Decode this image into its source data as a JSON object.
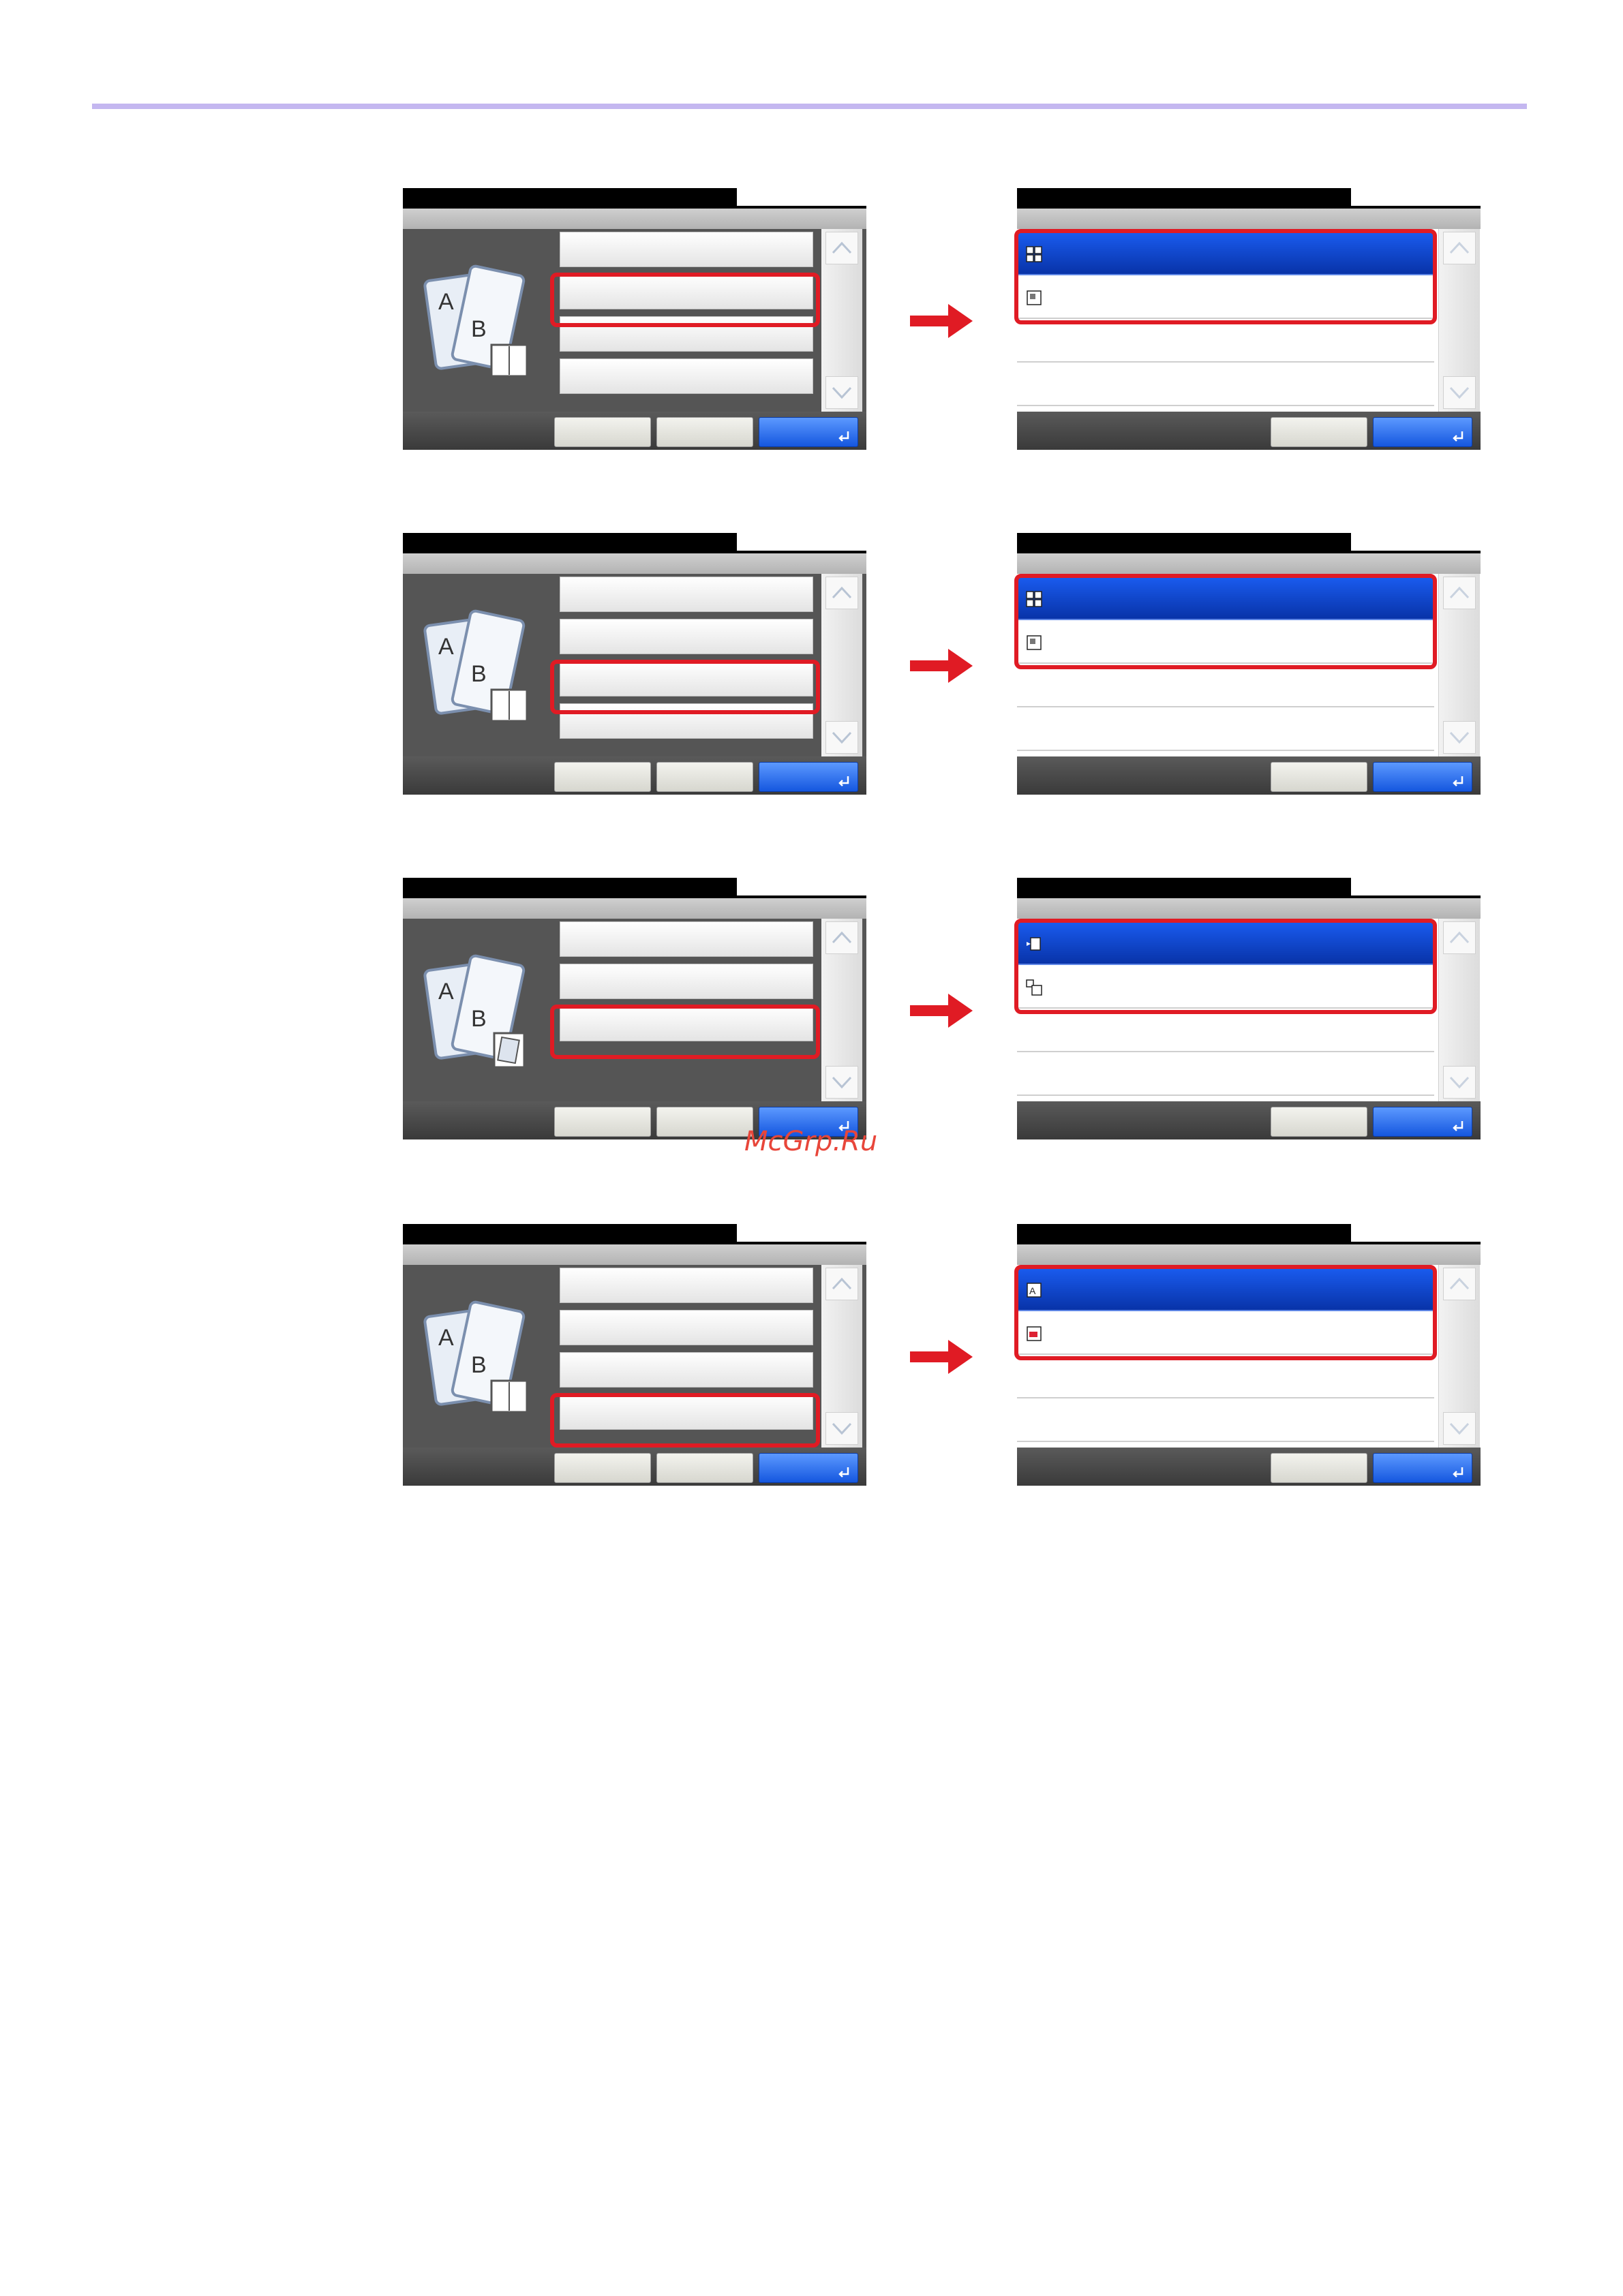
{
  "watermark": "McGrp.Ru",
  "colors": {
    "accent_red": "#e01b24",
    "selection_blue": "#0b41c8",
    "rule": "#c4b7f0"
  },
  "steps": [
    {
      "left_icon": "booklet-icon",
      "right_icons": [
        "booklet-layout-icon",
        "page-layout-icon"
      ]
    },
    {
      "left_icon": "booklet-icon",
      "right_icons": [
        "booklet-layout-icon",
        "page-layout-icon"
      ]
    },
    {
      "left_icon": "cover-icon",
      "right_icons": [
        "cover-front-icon",
        "cover-back-icon"
      ]
    },
    {
      "left_icon": "booklet-icon",
      "right_icons": [
        "image-icon",
        "image-edit-icon"
      ]
    }
  ]
}
